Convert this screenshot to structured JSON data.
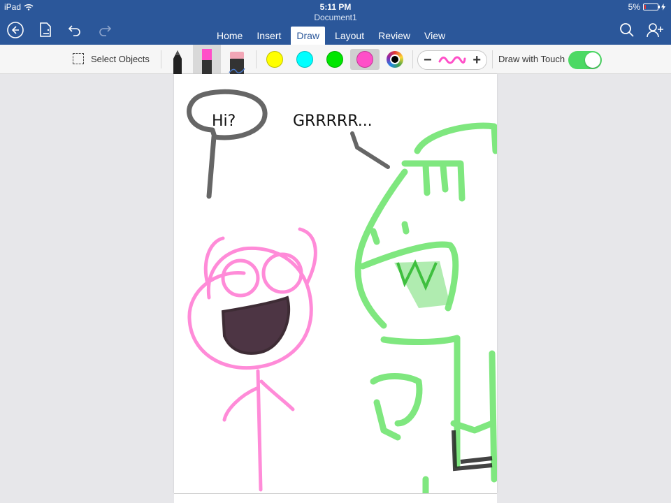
{
  "status": {
    "device": "iPad",
    "time": "5:11 PM",
    "battery": "5%"
  },
  "document": {
    "title": "Document1"
  },
  "tabs": [
    {
      "label": "Home"
    },
    {
      "label": "Insert"
    },
    {
      "label": "Draw"
    },
    {
      "label": "Layout"
    },
    {
      "label": "Review"
    },
    {
      "label": "View"
    }
  ],
  "ribbon": {
    "select_objects": "Select Objects",
    "draw_with_touch": "Draw with Touch",
    "colors": {
      "yellow": "#ffff00",
      "cyan": "#00ffff",
      "green": "#00e600",
      "pink": "#ff4fc8",
      "black": "#000000"
    }
  },
  "canvas": {
    "bubble_left_text": "Hi?",
    "bubble_right_text": "GRRRRR..."
  },
  "theme": {
    "title_bar": "#2b579a",
    "toggle_on": "#4cd964"
  }
}
